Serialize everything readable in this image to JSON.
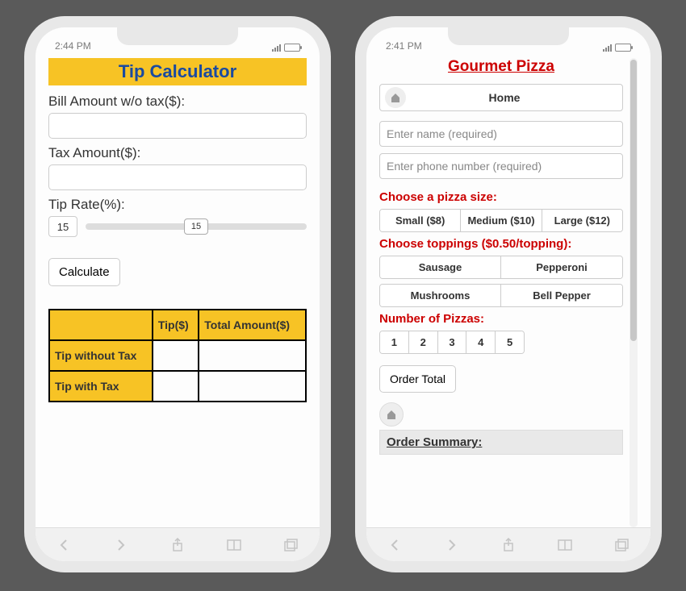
{
  "left": {
    "status_time": "2:44 PM",
    "title": "Tip Calculator",
    "bill_label": "Bill Amount w/o tax($):",
    "tax_label": "Tax Amount($):",
    "tip_rate_label": "Tip Rate(%):",
    "tip_rate_value": "15",
    "slider_value": "15",
    "calculate_label": "Calculate",
    "table": {
      "col_tip": "Tip($)",
      "col_total": "Total Amount($)",
      "row1": "Tip without Tax",
      "row2": "Tip with Tax"
    }
  },
  "right": {
    "status_time": "2:41 PM",
    "title": "Gourmet Pizza",
    "home_label": "Home",
    "name_placeholder": "Enter name (required)",
    "phone_placeholder": "Enter phone number (required)",
    "size_label": "Choose a pizza size:",
    "sizes": [
      "Small ($8)",
      "Medium ($10)",
      "Large ($12)"
    ],
    "toppings_label": "Choose toppings ($0.50/topping):",
    "toppings_row1": [
      "Sausage",
      "Pepperoni"
    ],
    "toppings_row2": [
      "Mushrooms",
      "Bell Pepper"
    ],
    "qty_label": "Number of Pizzas:",
    "qtys": [
      "1",
      "2",
      "3",
      "4",
      "5"
    ],
    "order_total_label": "Order Total",
    "summary_label": "Order Summary:"
  }
}
